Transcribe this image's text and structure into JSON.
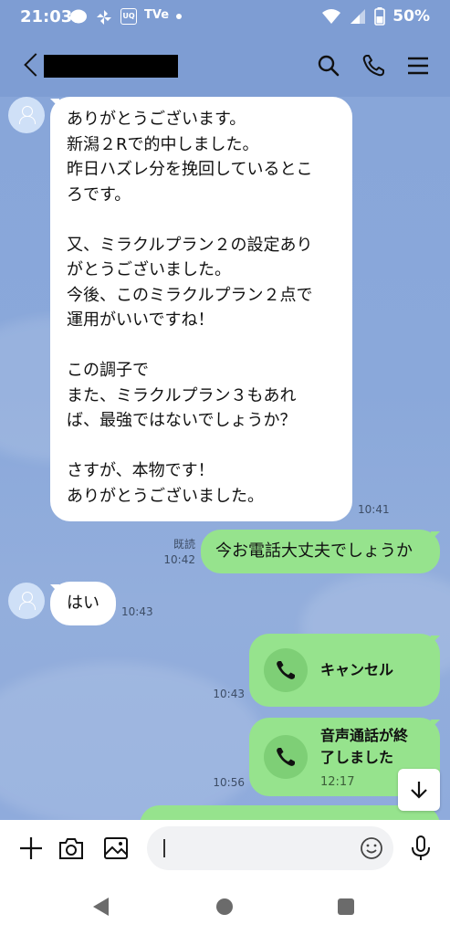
{
  "status_bar": {
    "time": "21:03",
    "icons_left": [
      "line-app-icon",
      "pinwheel-icon",
      "uq-icon",
      "tver-icon",
      "dot-icon"
    ],
    "uq_text": "UQ",
    "tv_text": "TVe",
    "battery": "50%"
  },
  "header": {
    "contact_name": "",
    "icons": [
      "search-icon",
      "phone-icon",
      "menu-icon"
    ]
  },
  "messages": {
    "m1": {
      "lines": [
        "ありがとうございます。",
        "新潟２Rで的中しました。",
        "昨日ハズレ分を挽回しているとこ",
        "ろです。",
        "",
        "又、ミラクルプラン２の設定あり",
        "がとうございました。",
        "今後、このミラクルプラン２点で",
        "運用がいいですね！",
        "",
        "この調子で",
        "また、ミラクルプラン３もあれ",
        "ば、最強ではないでしょうか？",
        "",
        "さすが、本物です！",
        "ありがとうございました。"
      ],
      "time": "10:41"
    },
    "m2": {
      "text": "今お電話大丈夫でしょうか",
      "read": "既読",
      "time": "10:42"
    },
    "m3": {
      "text": "はい",
      "time": "10:43"
    },
    "m4": {
      "label": "キャンセル",
      "time": "10:43"
    },
    "m5": {
      "label": "音声通話が終\n了しました",
      "duration": "12:17",
      "time": "10:56"
    },
    "m6": {
      "partial_text": "..."
    }
  },
  "input": {
    "placeholder": ""
  },
  "colors": {
    "chat_bg": "#88a6d9",
    "my_bubble": "#96e38d",
    "their_bubble": "#ffffff",
    "header": "#7e9dd3"
  }
}
